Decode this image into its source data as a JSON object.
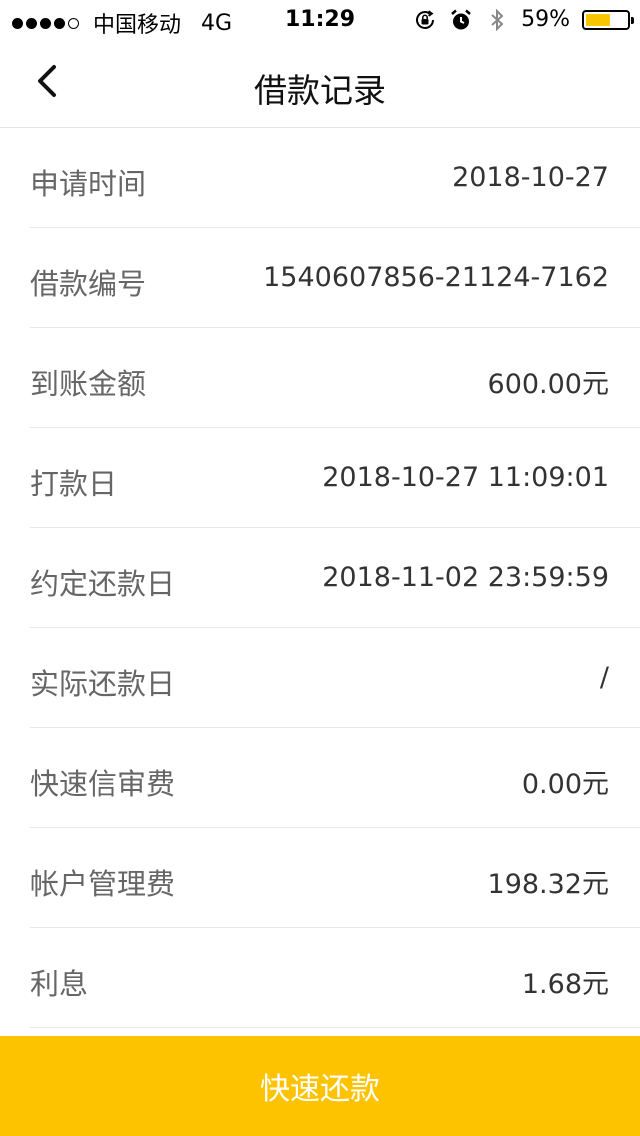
{
  "status_bar": {
    "carrier": "中国移动",
    "network": "4G",
    "time": "11:29",
    "battery_percent": "59%",
    "battery_level": 0.59,
    "signal_bars_filled": 4,
    "signal_bars_total": 5,
    "icons": [
      "rotation-lock-icon",
      "alarm-icon",
      "bluetooth-icon",
      "battery-icon"
    ]
  },
  "nav": {
    "title": "借款记录",
    "back_icon": "chevron-left-icon"
  },
  "details": [
    {
      "label": "申请时间",
      "value": "2018-10-27"
    },
    {
      "label": "借款编号",
      "value": "1540607856-21124-7162"
    },
    {
      "label": "到账金额",
      "value": "600.00元"
    },
    {
      "label": "打款日",
      "value": "2018-10-27 11:09:01"
    },
    {
      "label": "约定还款日",
      "value": "2018-11-02 23:59:59"
    },
    {
      "label": "实际还款日",
      "value": "/"
    },
    {
      "label": "快速信审费",
      "value": "0.00元"
    },
    {
      "label": "帐户管理费",
      "value": "198.32元"
    },
    {
      "label": "利息",
      "value": "1.68元"
    }
  ],
  "actions": {
    "repay_label": "快速还款"
  },
  "colors": {
    "accent": "#FDC300",
    "battery": "#F9C400",
    "label_text": "#666666",
    "value_text": "#333333",
    "divider": "#e8e8e8"
  }
}
